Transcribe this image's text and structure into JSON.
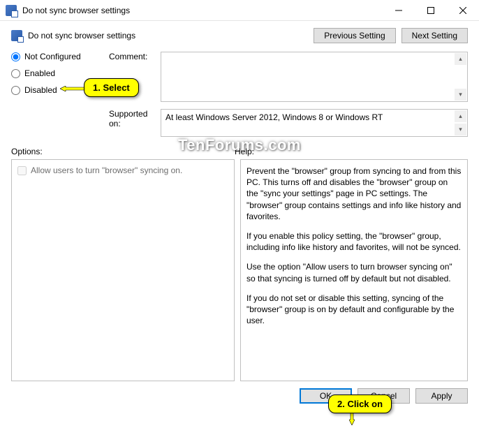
{
  "window": {
    "title": "Do not sync browser settings"
  },
  "header": {
    "title": "Do not sync browser settings",
    "prev": "Previous Setting",
    "next": "Next Setting"
  },
  "radios": {
    "not_configured": "Not Configured",
    "enabled": "Enabled",
    "disabled": "Disabled",
    "selected": "not_configured"
  },
  "labels": {
    "comment": "Comment:",
    "supported": "Supported on:",
    "options": "Options:",
    "help": "Help:"
  },
  "fields": {
    "comment": "",
    "supported": "At least Windows Server 2012, Windows 8 or Windows RT"
  },
  "options": {
    "allow_checkbox": "Allow users to turn \"browser\" syncing on."
  },
  "help": {
    "p1": "Prevent the \"browser\" group from syncing to and from this PC. This turns off and disables the \"browser\" group on the \"sync your settings\" page in PC settings.  The \"browser\" group contains settings and info like history and favorites.",
    "p2": "If you enable this policy setting, the \"browser\" group, including info like history and favorites, will not be synced.",
    "p3": "Use the option \"Allow users to turn browser syncing on\" so that syncing is turned off by default but not disabled.",
    "p4": "If you do not set or disable this setting, syncing of the \"browser\" group is on by default and configurable by the user."
  },
  "buttons": {
    "ok": "OK",
    "cancel": "Cancel",
    "apply": "Apply"
  },
  "annotations": {
    "callout1": "1. Select",
    "callout2": "2. Click on"
  },
  "watermark": "TenForums.com"
}
